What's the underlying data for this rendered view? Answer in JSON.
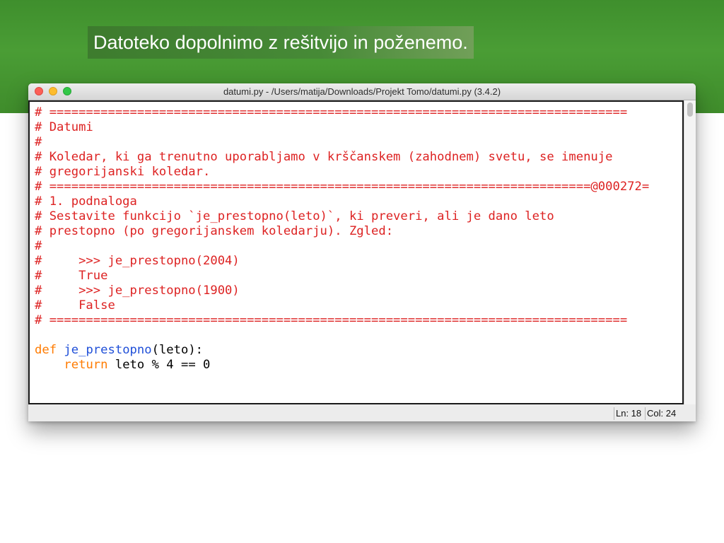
{
  "slide": {
    "title": "Datoteko dopolnimo z rešitvijo in poženemo."
  },
  "window": {
    "title": "datumi.py - /Users/matija/Downloads/Projekt Tomo/datumi.py (3.4.2)",
    "buttons": [
      "close",
      "minimize",
      "maximize"
    ]
  },
  "editor": {
    "lines": [
      [
        {
          "t": "# ===============================================================================",
          "c": "comment"
        }
      ],
      [
        {
          "t": "# Datumi",
          "c": "comment"
        }
      ],
      [
        {
          "t": "#",
          "c": "comment"
        }
      ],
      [
        {
          "t": "# Koledar, ki ga trenutno uporabljamo v krščanskem (zahodnem) svetu, se imenuje",
          "c": "comment"
        }
      ],
      [
        {
          "t": "# gregorijanski koledar.",
          "c": "comment"
        }
      ],
      [
        {
          "t": "# ==========================================================================@000272=",
          "c": "comment"
        }
      ],
      [
        {
          "t": "# 1. podnaloga",
          "c": "comment"
        }
      ],
      [
        {
          "t": "# Sestavite funkcijo `je_prestopno(leto)`, ki preveri, ali je dano leto",
          "c": "comment"
        }
      ],
      [
        {
          "t": "# prestopno (po gregorijanskem koledarju). Zgled:",
          "c": "comment"
        }
      ],
      [
        {
          "t": "#",
          "c": "comment"
        }
      ],
      [
        {
          "t": "#     >>> je_prestopno(2004)",
          "c": "comment"
        }
      ],
      [
        {
          "t": "#     True",
          "c": "comment"
        }
      ],
      [
        {
          "t": "#     >>> je_prestopno(1900)",
          "c": "comment"
        }
      ],
      [
        {
          "t": "#     False",
          "c": "comment"
        }
      ],
      [
        {
          "t": "# ===============================================================================",
          "c": "comment"
        }
      ],
      [],
      [
        {
          "t": "def",
          "c": "keyword"
        },
        {
          "t": " ",
          "c": "text"
        },
        {
          "t": "je_prestopno",
          "c": "function"
        },
        {
          "t": "(leto):",
          "c": "text"
        }
      ],
      [
        {
          "t": "    ",
          "c": "text"
        },
        {
          "t": "return",
          "c": "keyword"
        },
        {
          "t": " leto % 4 == 0",
          "c": "text"
        }
      ]
    ]
  },
  "statusbar": {
    "line": "Ln: 18",
    "col": "Col: 24"
  },
  "colors": {
    "comment": "#dd2222",
    "keyword": "#ff7b00",
    "function": "#1f4fd8",
    "text": "#000000",
    "slide_green": "#4a9d35"
  }
}
